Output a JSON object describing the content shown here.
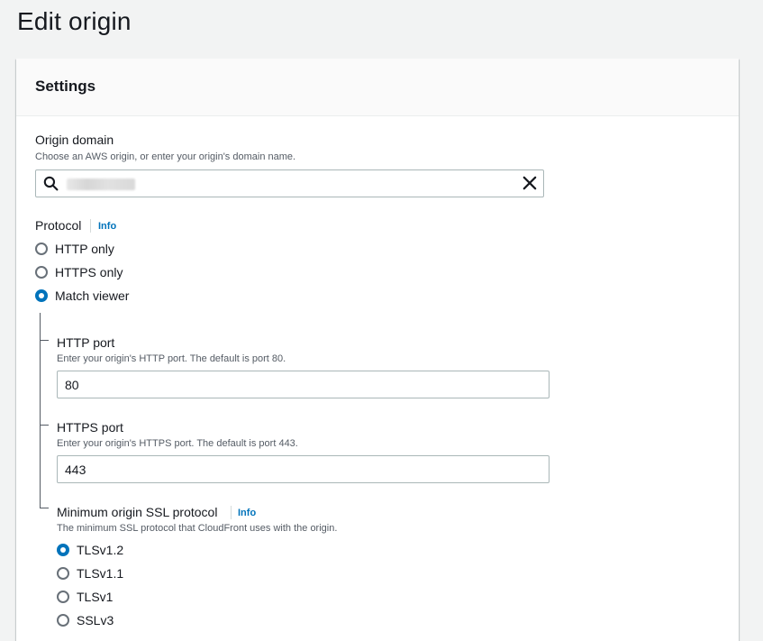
{
  "page_title": "Edit origin",
  "panel": {
    "title": "Settings"
  },
  "origin_domain": {
    "label": "Origin domain",
    "description": "Choose an AWS origin, or enter your origin's domain name.",
    "icons": {
      "search": "search-icon",
      "clear": "close-icon"
    }
  },
  "protocol": {
    "label": "Protocol",
    "info": "Info",
    "options": [
      {
        "label": "HTTP only",
        "selected": false
      },
      {
        "label": "HTTPS only",
        "selected": false
      },
      {
        "label": "Match viewer",
        "selected": true
      }
    ]
  },
  "http_port": {
    "label": "HTTP port",
    "description": "Enter your origin's HTTP port. The default is port 80.",
    "value": "80"
  },
  "https_port": {
    "label": "HTTPS port",
    "description": "Enter your origin's HTTPS port. The default is port 443.",
    "value": "443"
  },
  "min_ssl": {
    "label": "Minimum origin SSL protocol",
    "info": "Info",
    "description": "The minimum SSL protocol that CloudFront uses with the origin.",
    "options": [
      {
        "label": "TLSv1.2",
        "selected": true
      },
      {
        "label": "TLSv1.1",
        "selected": false
      },
      {
        "label": "TLSv1",
        "selected": false
      },
      {
        "label": "SSLv3",
        "selected": false
      }
    ]
  },
  "colors": {
    "accent": "#0073bb",
    "background": "#f2f3f3",
    "border": "#aab7b8"
  }
}
